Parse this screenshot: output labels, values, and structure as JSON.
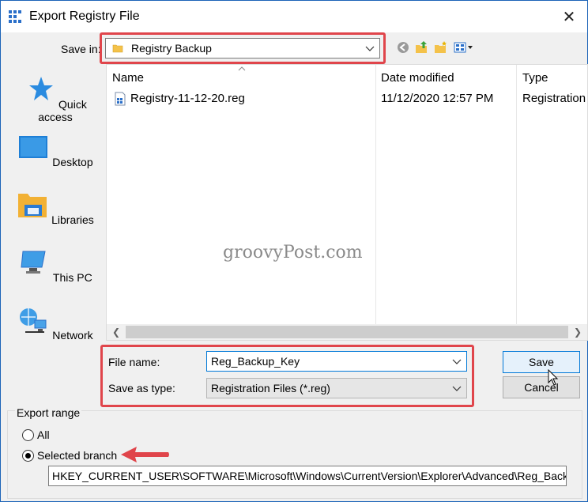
{
  "window": {
    "title": "Export Registry File",
    "close_glyph": "✕"
  },
  "toolbar": {
    "save_in_label": "Save in:",
    "save_in_value": "Registry Backup"
  },
  "places": [
    {
      "label": "Quick access",
      "icon": "star-icon"
    },
    {
      "label": "Desktop",
      "icon": "desktop-icon"
    },
    {
      "label": "Libraries",
      "icon": "libraries-icon"
    },
    {
      "label": "This PC",
      "icon": "computer-icon"
    },
    {
      "label": "Network",
      "icon": "network-icon"
    }
  ],
  "filelist": {
    "columns": [
      "Name",
      "Date modified",
      "Type"
    ],
    "rows": [
      {
        "name": "Registry-11-12-20.reg",
        "date": "11/12/2020 12:57 PM",
        "type": "Registration"
      }
    ]
  },
  "watermark": "groovyPost.com",
  "form": {
    "file_name_label": "File name:",
    "file_name_value": "Reg_Backup_Key",
    "save_as_type_label": "Save as type:",
    "save_as_type_value": "Registration Files (*.reg)",
    "save_button": "Save",
    "cancel_button": "Cancel"
  },
  "export_range": {
    "title": "Export range",
    "all_label": "All",
    "selected_label": "Selected branch",
    "selected": "Selected branch",
    "branch_value": "HKEY_CURRENT_USER\\SOFTWARE\\Microsoft\\Windows\\CurrentVersion\\Explorer\\Advanced\\Reg_Backup"
  },
  "colors": {
    "highlight": "#e0454b",
    "accent": "#0078d7"
  }
}
